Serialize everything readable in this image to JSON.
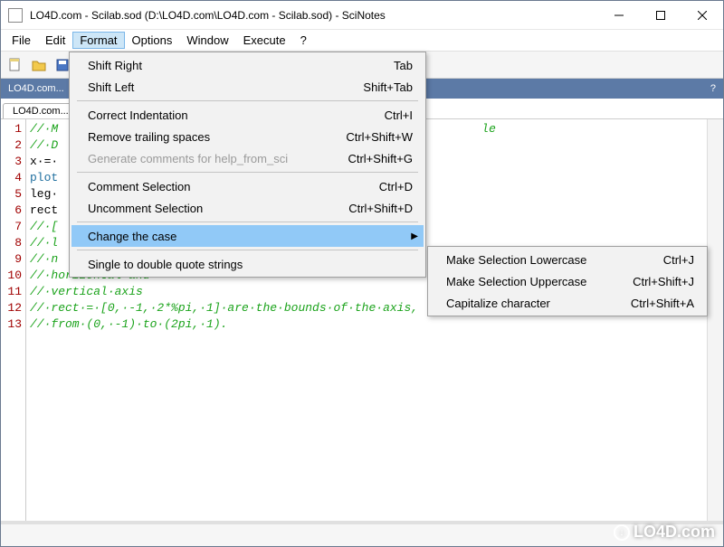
{
  "titlebar": {
    "title": "LO4D.com - Scilab.sod (D:\\LO4D.com\\LO4D.com - Scilab.sod) - SciNotes"
  },
  "menubar": {
    "items": [
      "File",
      "Edit",
      "Format",
      "Options",
      "Window",
      "Execute",
      "?"
    ],
    "open_index": 2
  },
  "panel": {
    "title": "LO4D.com...",
    "help_symbol": "?"
  },
  "file_tab": {
    "label": "LO4D.com..."
  },
  "format_menu": {
    "groups": [
      [
        {
          "label": "Shift Right",
          "shortcut": "Tab"
        },
        {
          "label": "Shift Left",
          "shortcut": "Shift+Tab"
        }
      ],
      [
        {
          "label": "Correct Indentation",
          "shortcut": "Ctrl+I"
        },
        {
          "label": "Remove trailing spaces",
          "shortcut": "Ctrl+Shift+W"
        },
        {
          "label": "Generate comments for help_from_sci",
          "shortcut": "Ctrl+Shift+G",
          "disabled": true
        }
      ],
      [
        {
          "label": "Comment Selection",
          "shortcut": "Ctrl+D"
        },
        {
          "label": "Uncomment Selection",
          "shortcut": "Ctrl+Shift+D"
        }
      ],
      [
        {
          "label": "Change the case",
          "submenu": true,
          "highlight": true
        }
      ],
      [
        {
          "label": "Single to double quote strings"
        }
      ]
    ]
  },
  "case_submenu": {
    "items": [
      {
        "label": "Make Selection Lowercase",
        "shortcut": "Ctrl+J"
      },
      {
        "label": "Make Selection Uppercase",
        "shortcut": "Ctrl+Shift+J"
      },
      {
        "label": "Capitalize character",
        "shortcut": "Ctrl+Shift+A"
      }
    ]
  },
  "editor": {
    "line_count": 13,
    "lines": [
      {
        "text": "//·M",
        "class": "c-comment",
        "tail": "le",
        "tail_class": "c-comment"
      },
      {
        "text": "//·D",
        "class": "c-comment"
      },
      {
        "text": "x·=·",
        "class": "c-black"
      },
      {
        "text": "plot",
        "class": "c-kw"
      },
      {
        "text": "leg·",
        "class": "c-black"
      },
      {
        "text": "rect",
        "class": "c-black"
      },
      {
        "text": "//·[",
        "class": "c-comment"
      },
      {
        "text": "//·l",
        "class": "c-comment"
      },
      {
        "text": "//·n",
        "class": "c-comment"
      },
      {
        "text": "//·horizontal·and",
        "class": "c-comment"
      },
      {
        "text": "//·vertical·axis",
        "class": "c-comment"
      },
      {
        "text": "//·rect·=·[0,·-1,·2*%pi,·1]·are·the·bounds·of·the·axis,",
        "class": "c-comment"
      },
      {
        "text": "//·from·(0,·-1)·to·(2pi,·1).",
        "class": "c-comment"
      }
    ]
  },
  "watermark": {
    "text": "LO4D.com"
  }
}
